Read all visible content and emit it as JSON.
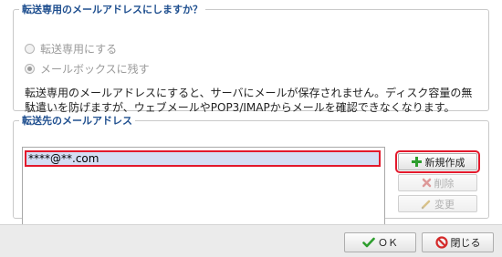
{
  "section1": {
    "legend": "転送専用のメールアドレスにしますか？",
    "options": [
      {
        "label": "転送専用にする",
        "checked": false
      },
      {
        "label": "メールボックスに残す",
        "checked": true
      }
    ],
    "description": "転送専用のメールアドレスにすると、サーバにメールが保存されません。ディスク容量の無駄遣いを防げますが、ウェブメールやPOP3/IMAPからメールを確認できなくなります。"
  },
  "section2": {
    "legend": "転送先のメールアドレス",
    "addresses": [
      "****@**.com"
    ],
    "buttons": {
      "new": "新規作成",
      "delete": "削除",
      "edit": "変更"
    }
  },
  "footer": {
    "ok": "ＯＫ",
    "close": "閉じる"
  },
  "colors": {
    "legend": "#1f4f8f",
    "highlight": "#e3192c",
    "selection": "#d4def4",
    "add_icon": "#2e9e2e",
    "ok_icon": "#2e9e2e",
    "close_icon": "#d42a2a"
  }
}
